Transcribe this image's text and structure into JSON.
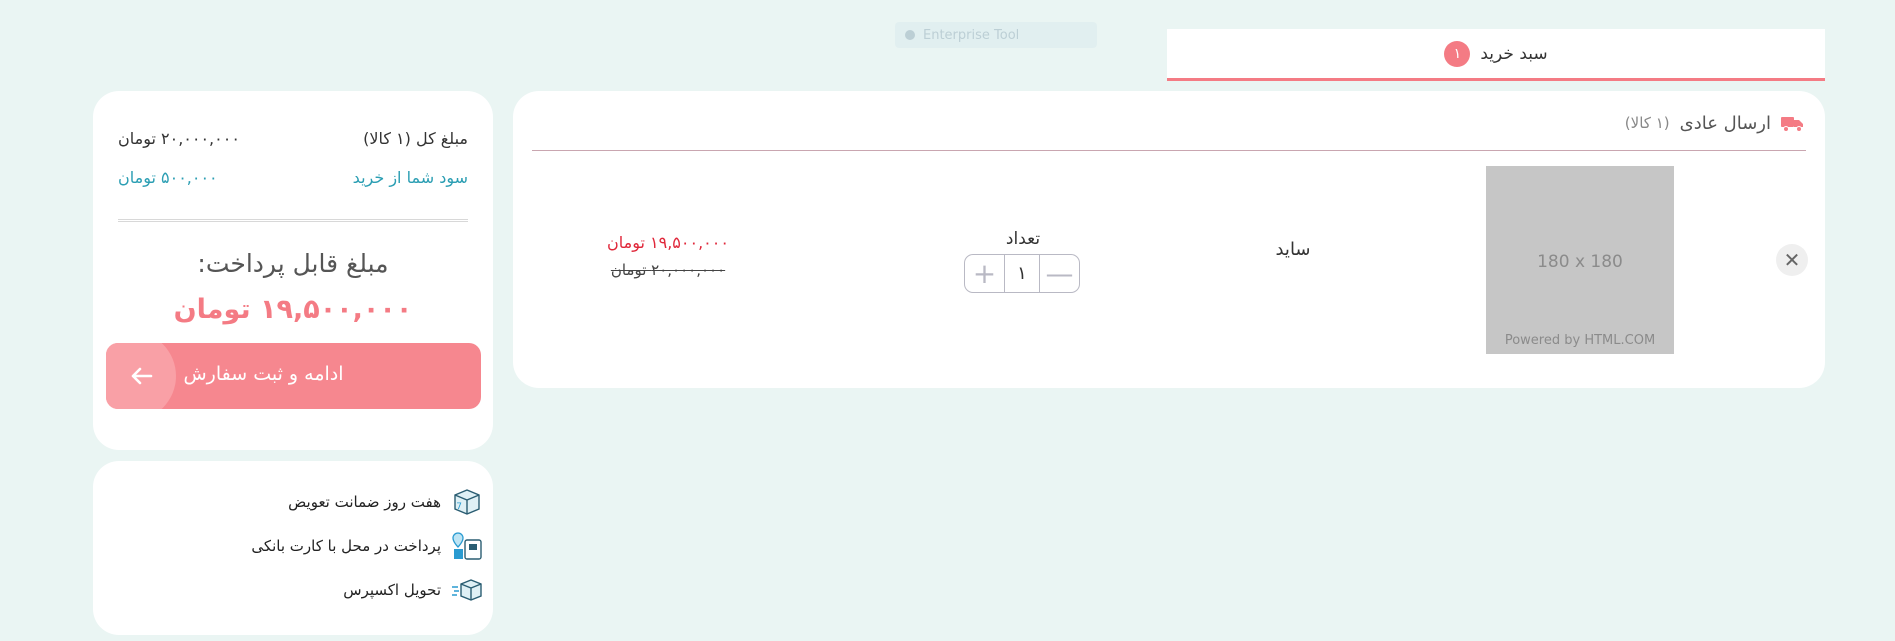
{
  "header": {
    "faded_crumb": "Enterprise Tool",
    "tab": {
      "label": "سبد خرید",
      "badge": "۱"
    }
  },
  "cart": {
    "shipping": {
      "title": "ارسال عادی",
      "count": "(۱ کالا)"
    },
    "item": {
      "remove_icon": "close-icon",
      "image_dim": "180 x 180",
      "image_powered": "Powered by HTML.COM",
      "name": "ساید",
      "qty_label": "تعداد",
      "qty_value": "۱",
      "price_new": "۱۹,۵۰۰,۰۰۰ تومان",
      "price_old": "۲۰,۰۰۰,۰۰۰ تومان"
    }
  },
  "summary": {
    "total_label": "مبلغ کل (۱ کالا)",
    "total_value": "۲۰,۰۰۰,۰۰۰ تومان",
    "profit_label": "سود شما از خرید",
    "profit_value": "۵۰۰,۰۰۰ تومان",
    "payable_label": "مبلغ قابل پرداخت:",
    "payable_value": "۱۹,۵۰۰,۰۰۰ تومان",
    "checkout_label": "ادامه و ثبت سفارش"
  },
  "features": [
    {
      "icon": "guarantee-box-icon",
      "label": "هفت روز ضمانت تعویض"
    },
    {
      "icon": "card-payment-icon",
      "label": "پرداخت در محل با کارت بانکی"
    },
    {
      "icon": "express-box-icon",
      "label": "تحویل اکسپرس"
    }
  ],
  "colors": {
    "accent": "#f47b84",
    "price_red": "#e0273a",
    "profit_teal": "#2b9eb3",
    "background": "#eaf5f3"
  }
}
